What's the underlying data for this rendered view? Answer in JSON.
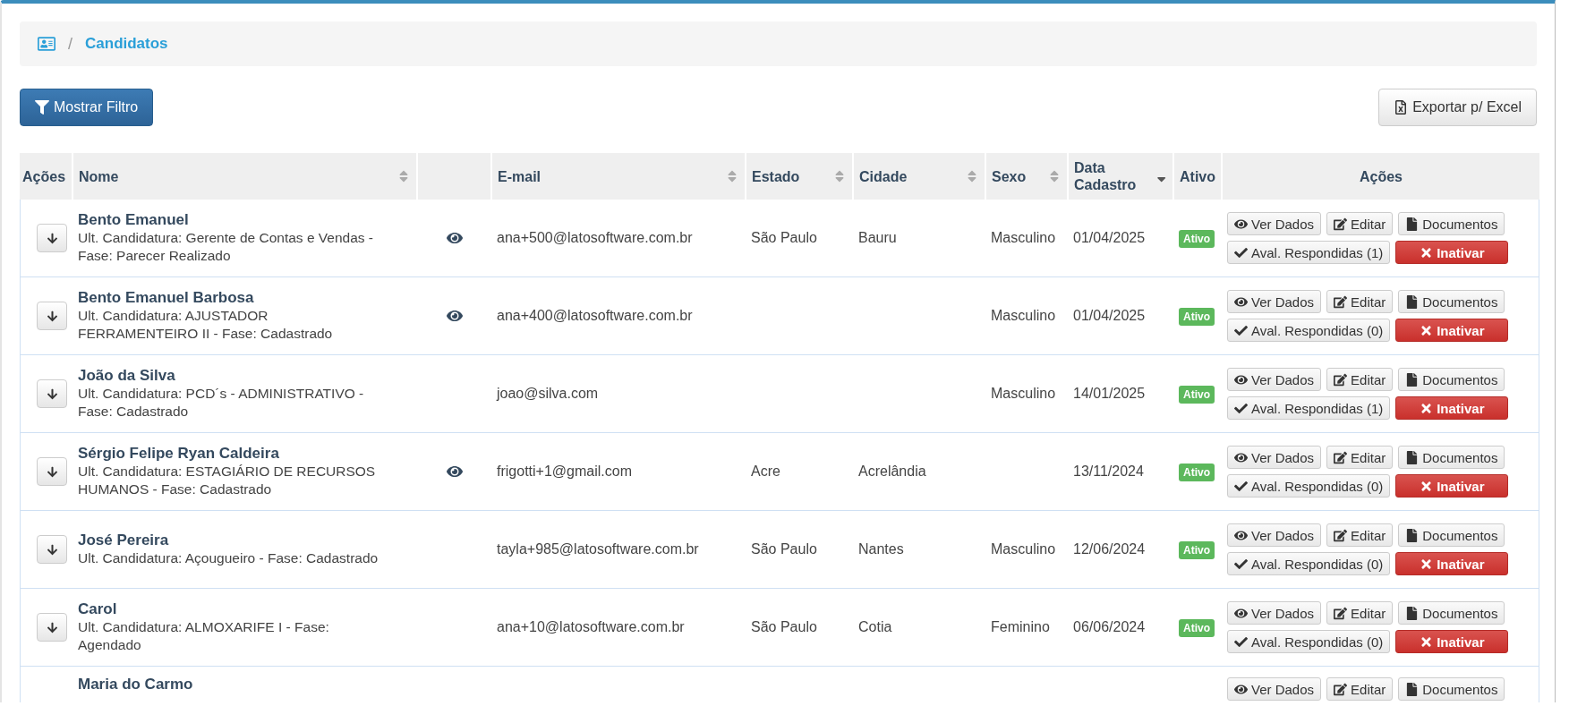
{
  "breadcrumb": {
    "separator": "/",
    "label": "Candidatos"
  },
  "toolbar": {
    "filter_button": "Mostrar Filtro",
    "export_button": "Exportar p/ Excel"
  },
  "table": {
    "columns": [
      {
        "label": "Ações",
        "sortable": false,
        "sorted": false
      },
      {
        "label": "Nome",
        "sortable": true,
        "sorted": false
      },
      {
        "sortable": false,
        "sorted": false
      },
      {
        "label": "E-mail",
        "sortable": true,
        "sorted": false
      },
      {
        "label": "Estado",
        "sortable": true,
        "sorted": false
      },
      {
        "label": "Cidade",
        "sortable": true,
        "sorted": false
      },
      {
        "label": "Sexo",
        "sortable": true,
        "sorted": false
      },
      {
        "label": "Data Cadastro",
        "sortable": true,
        "sorted": true
      },
      {
        "label": "Ativo",
        "sortable": false,
        "sorted": false
      },
      {
        "label": "Ações",
        "sortable": false,
        "sorted": false
      }
    ],
    "rows": [
      {
        "name": "Bento Emanuel",
        "candidatura": "Ult. Candidatura: Gerente de Contas e Vendas - Fase: Parecer Realizado",
        "profile_view": true,
        "email": "ana+500@latosoftware.com.br",
        "estado": "São Paulo",
        "cidade": "Bauru",
        "sexo": "Masculino",
        "data": "01/04/2025",
        "status": "Ativo",
        "actions": [
          {
            "label": "Ver Dados",
            "kind": "view"
          },
          {
            "label": "Editar",
            "kind": "edit"
          },
          {
            "label": "Documentos",
            "kind": "document"
          },
          {
            "label": "Aval. Respondidas (1)",
            "kind": "answers"
          },
          {
            "label": "Inativar",
            "kind": "deactivate"
          }
        ]
      },
      {
        "name": "Bento Emanuel Barbosa",
        "candidatura": "Ult. Candidatura: AJUSTADOR FERRAMENTEIRO II - Fase: Cadastrado",
        "profile_view": true,
        "email": "ana+400@latosoftware.com.br",
        "sexo": "Masculino",
        "data": "01/04/2025",
        "status": "Ativo",
        "actions": [
          {
            "label": "Ver Dados",
            "kind": "view"
          },
          {
            "label": "Editar",
            "kind": "edit"
          },
          {
            "label": "Documentos",
            "kind": "document"
          },
          {
            "label": "Aval. Respondidas (0)",
            "kind": "answers"
          },
          {
            "label": "Inativar",
            "kind": "deactivate"
          }
        ]
      },
      {
        "name": "João da Silva",
        "candidatura": "Ult. Candidatura: PCD´s - ADMINISTRATIVO - Fase: Cadastrado",
        "profile_view": false,
        "email": "joao@silva.com",
        "sexo": "Masculino",
        "data": "14/01/2025",
        "status": "Ativo",
        "actions": [
          {
            "label": "Ver Dados",
            "kind": "view"
          },
          {
            "label": "Editar",
            "kind": "edit"
          },
          {
            "label": "Documentos",
            "kind": "document"
          },
          {
            "label": "Aval. Respondidas (1)",
            "kind": "answers"
          },
          {
            "label": "Inativar",
            "kind": "deactivate"
          }
        ]
      },
      {
        "name": "Sérgio Felipe Ryan Caldeira",
        "candidatura": "Ult. Candidatura: ESTAGIÁRIO DE RECURSOS HUMANOS - Fase: Cadastrado",
        "profile_view": true,
        "email": "frigotti+1@gmail.com",
        "estado": "Acre",
        "cidade": "Acrelândia",
        "data": "13/11/2024",
        "status": "Ativo",
        "actions": [
          {
            "label": "Ver Dados",
            "kind": "view"
          },
          {
            "label": "Editar",
            "kind": "edit"
          },
          {
            "label": "Documentos",
            "kind": "document"
          },
          {
            "label": "Aval. Respondidas (0)",
            "kind": "answers"
          },
          {
            "label": "Inativar",
            "kind": "deactivate"
          }
        ]
      },
      {
        "name": "José Pereira",
        "candidatura": "Ult. Candidatura: Açougueiro - Fase: Cadastrado",
        "profile_view": false,
        "email": "tayla+985@latosoftware.com.br",
        "estado": "São Paulo",
        "cidade": "Nantes",
        "sexo": "Masculino",
        "data": "12/06/2024",
        "status": "Ativo",
        "actions": [
          {
            "label": "Ver Dados",
            "kind": "view"
          },
          {
            "label": "Editar",
            "kind": "edit"
          },
          {
            "label": "Documentos",
            "kind": "document"
          },
          {
            "label": "Aval. Respondidas (0)",
            "kind": "answers"
          },
          {
            "label": "Inativar",
            "kind": "deactivate"
          }
        ]
      },
      {
        "name": "Carol",
        "candidatura": "Ult. Candidatura: ALMOXARIFE I - Fase: Agendado",
        "profile_view": false,
        "email": "ana+10@latosoftware.com.br",
        "estado": "São Paulo",
        "cidade": "Cotia",
        "sexo": "Feminino",
        "data": "06/06/2024",
        "status": "Ativo",
        "actions": [
          {
            "label": "Ver Dados",
            "kind": "view"
          },
          {
            "label": "Editar",
            "kind": "edit"
          },
          {
            "label": "Documentos",
            "kind": "document"
          },
          {
            "label": "Aval. Respondidas (0)",
            "kind": "answers"
          },
          {
            "label": "Inativar",
            "kind": "deactivate"
          }
        ]
      },
      {
        "name": "Maria do Carmo",
        "profile_view": false,
        "actions": [
          {
            "label": "Ver Dados",
            "kind": "view"
          },
          {
            "label": "Editar",
            "kind": "edit"
          },
          {
            "label": "Documentos",
            "kind": "document"
          }
        ]
      }
    ]
  }
}
